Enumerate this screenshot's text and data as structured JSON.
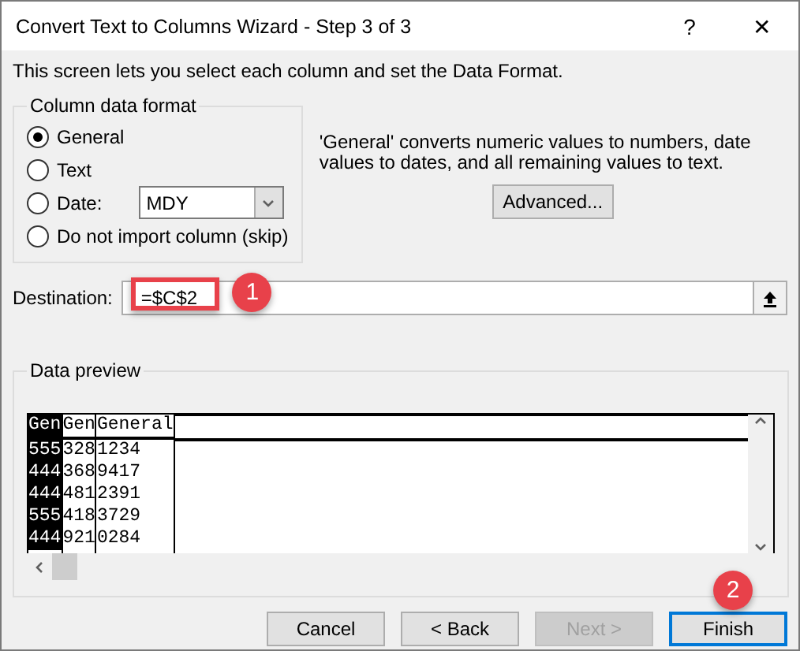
{
  "window": {
    "title": "Convert Text to Columns Wizard - Step 3 of 3",
    "help": "?",
    "close": "✕"
  },
  "intro": "This screen lets you select each column and set the Data Format.",
  "format_group": {
    "title": "Column data format",
    "options": [
      {
        "label": "General",
        "selected": true,
        "kind": "plain"
      },
      {
        "label": "Text",
        "selected": false,
        "kind": "plain"
      },
      {
        "label": "Date:",
        "selected": false,
        "kind": "date",
        "value": "MDY"
      },
      {
        "label": "Do not import column (skip)",
        "selected": false,
        "kind": "plain"
      }
    ]
  },
  "description": "'General' converts numeric values to numbers, date values to dates, and all remaining values to text.",
  "advanced_button": "Advanced...",
  "destination": {
    "label": "Destination:",
    "value": "=$C$2",
    "badge": "1"
  },
  "preview": {
    "title": "Data preview",
    "columns": [
      {
        "header": "Gen",
        "selected": true,
        "cells": [
          "555",
          "444",
          "444",
          "555",
          "444"
        ]
      },
      {
        "header": "Gen",
        "selected": false,
        "cells": [
          "328",
          "368",
          "481",
          "418",
          "921"
        ]
      },
      {
        "header": "General",
        "selected": false,
        "cells": [
          "1234",
          "9417",
          "2391",
          "3729",
          "0284"
        ]
      }
    ]
  },
  "buttons": [
    {
      "label": "Cancel",
      "disabled": false,
      "default": false
    },
    {
      "label": "< Back",
      "disabled": false,
      "default": false
    },
    {
      "label": "Next >",
      "disabled": true,
      "default": false
    },
    {
      "label": "Finish",
      "disabled": false,
      "default": true,
      "badge": "2"
    }
  ]
}
